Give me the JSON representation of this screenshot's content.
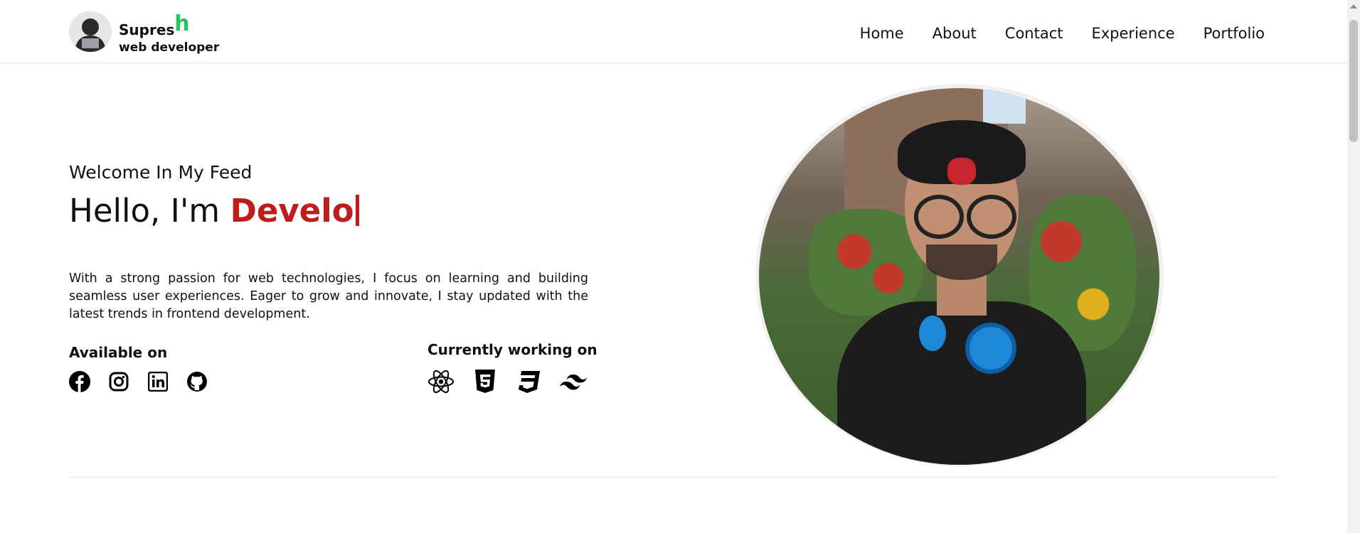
{
  "header": {
    "brand_name": "Supres",
    "brand_accent": "h",
    "brand_subtitle": "web developer",
    "nav": [
      "Home",
      "About",
      "Contact",
      "Experience",
      "Portfolio"
    ]
  },
  "hero": {
    "welcome": "Welcome In My Feed",
    "hello_prefix": "Hello, I'm",
    "typed_text": "Develo",
    "description": "With a strong passion for web technologies, I focus on learning and building seamless user experiences. Eager to grow and innovate, I stay updated with the latest trends in frontend development.",
    "available_title": "Available on",
    "socials": [
      "facebook-icon",
      "instagram-icon",
      "linkedin-icon",
      "github-icon"
    ],
    "working_title": "Currently working on",
    "tech": [
      "react-icon",
      "html5-icon",
      "css3-icon",
      "tailwind-icon"
    ]
  },
  "colors": {
    "accent_red": "#c01c1c",
    "brand_green": "#22c55e"
  }
}
